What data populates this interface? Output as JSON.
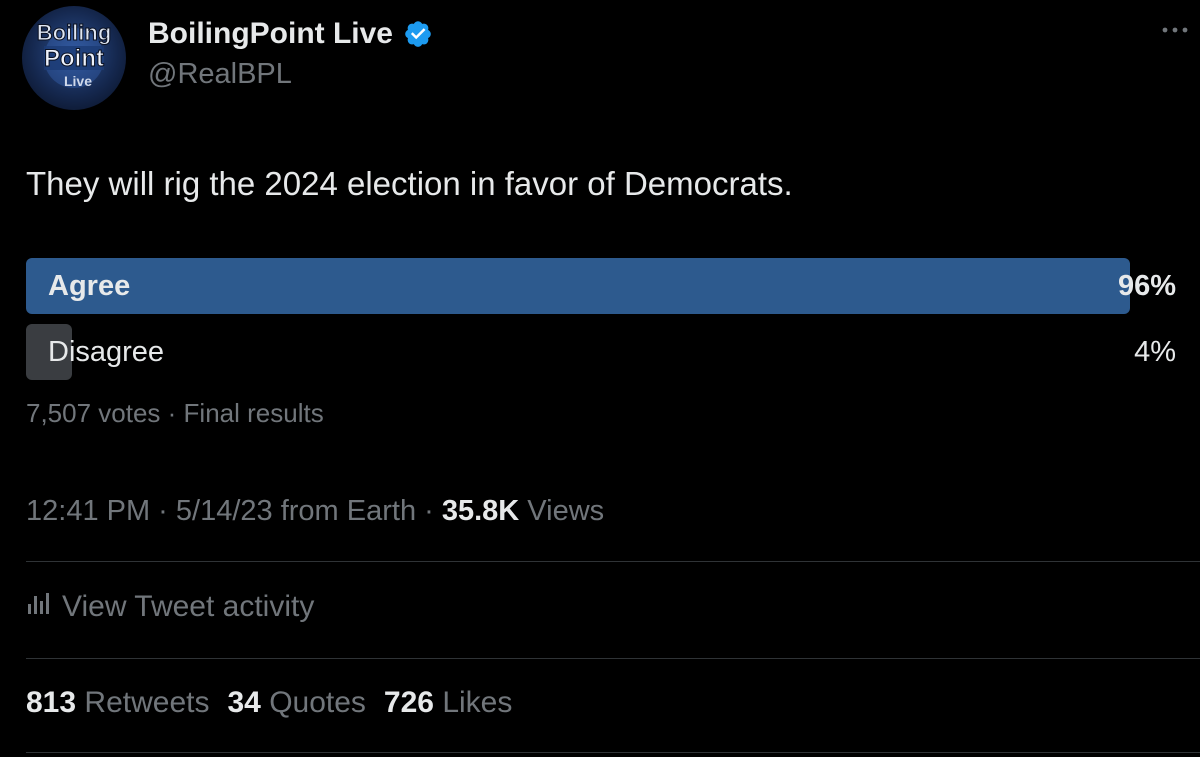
{
  "author": {
    "display_name": "BoilingPoint Live",
    "handle": "@RealBPL",
    "verified": true,
    "avatar_logo_text": [
      "Boiling",
      "Point",
      "Live"
    ]
  },
  "tweet": {
    "text": "They will rig the 2024 election in favor of Democrats."
  },
  "poll": {
    "options": [
      {
        "label": "Agree",
        "percent_text": "96%",
        "percent": 96,
        "winner": true
      },
      {
        "label": "Disagree",
        "percent_text": "4%",
        "percent": 4,
        "winner": false
      }
    ],
    "meta": "7,507 votes · Final results"
  },
  "timestamp": {
    "time_date": "12:41 PM · 5/14/23 from Earth · ",
    "views_count": "35.8K",
    "views_label": " Views"
  },
  "activity": {
    "label": "View Tweet activity",
    "icon": "bar-chart-icon"
  },
  "stats": [
    {
      "count": "813",
      "label": "Retweets"
    },
    {
      "count": "34",
      "label": "Quotes"
    },
    {
      "count": "726",
      "label": "Likes"
    }
  ],
  "colors": {
    "background": "#000000",
    "text_primary": "#e7e9ea",
    "text_secondary": "#71767b",
    "poll_winner": "#2d5a8e",
    "poll_loser": "#3a3d41",
    "verified_badge": "#1d9bf0",
    "divider": "#2f3336"
  }
}
